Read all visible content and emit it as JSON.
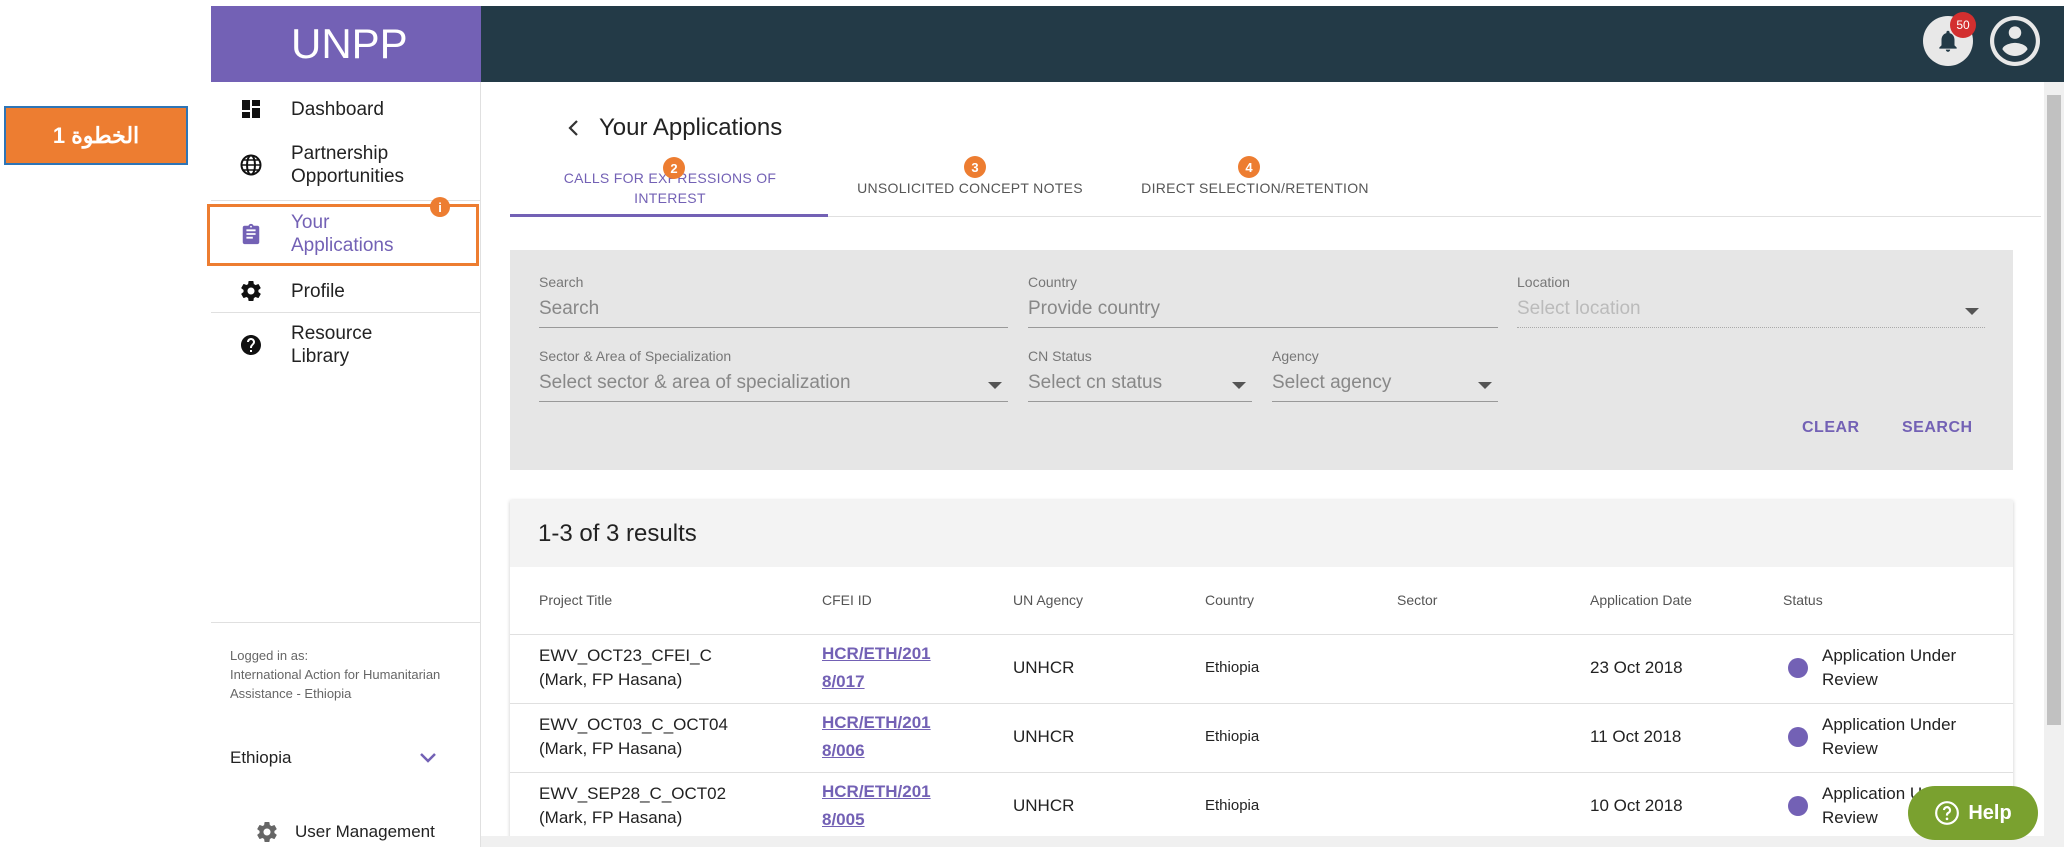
{
  "callout": {
    "label": "الخطوة 1"
  },
  "brand": {
    "name": "UNPP"
  },
  "topbar": {
    "notification_count": "50"
  },
  "sidebar": {
    "items": [
      {
        "label": "Dashboard",
        "icon": "dashboard-icon"
      },
      {
        "label": "Partnership Opportunities",
        "icon": "globe-icon"
      },
      {
        "label": "Your Applications",
        "icon": "clipboard-icon"
      },
      {
        "label": "Profile",
        "icon": "gear-icon"
      },
      {
        "label": "Resource Library",
        "icon": "help-circle-icon"
      }
    ],
    "logged_in_label": "Logged in as:",
    "logged_in_org": "International Action for Humanitarian Assistance - Ethiopia",
    "country": "Ethiopia",
    "user_management": "User Management"
  },
  "markers": {
    "m1": "i",
    "m2": "2",
    "m3": "3",
    "m4": "4"
  },
  "page": {
    "title": "Your Applications",
    "tabs": [
      {
        "label": "CALLS FOR EXPRESSIONS OF INTEREST"
      },
      {
        "label": "UNSOLICITED CONCEPT NOTES"
      },
      {
        "label": "DIRECT SELECTION/RETENTION"
      }
    ]
  },
  "filters": {
    "search_label": "Search",
    "search_placeholder": "Search",
    "country_label": "Country",
    "country_placeholder": "Provide country",
    "location_label": "Location",
    "location_placeholder": "Select location",
    "sector_label": "Sector & Area of Specialization",
    "sector_placeholder": "Select sector & area of specialization",
    "cn_status_label": "CN Status",
    "cn_status_placeholder": "Select cn status",
    "agency_label": "Agency",
    "agency_placeholder": "Select agency",
    "clear": "CLEAR",
    "search": "SEARCH"
  },
  "results": {
    "summary": "1-3 of 3 results",
    "columns": [
      "Project Title",
      "CFEI ID",
      "UN Agency",
      "Country",
      "Sector",
      "Application Date",
      "Status"
    ],
    "rows": [
      {
        "title_1": "EWV_OCT23_CFEI_C",
        "title_2": "(Mark, FP Hasana)",
        "cfei_1": "HCR/ETH/201",
        "cfei_2": "8/017",
        "agency": "UNHCR",
        "country": "Ethiopia",
        "date": "23 Oct 2018",
        "status_1": "Application Under",
        "status_2": "Review"
      },
      {
        "title_1": "EWV_OCT03_C_OCT04",
        "title_2": "(Mark, FP Hasana)",
        "cfei_1": "HCR/ETH/201",
        "cfei_2": "8/006",
        "agency": "UNHCR",
        "country": "Ethiopia",
        "date": "11 Oct 2018",
        "status_1": "Application Under",
        "status_2": "Review"
      },
      {
        "title_1": "EWV_SEP28_C_OCT02",
        "title_2": "(Mark, FP Hasana)",
        "cfei_1": "HCR/ETH/201",
        "cfei_2": "8/005",
        "agency": "UNHCR",
        "country": "Ethiopia",
        "date": "10 Oct 2018",
        "status_1": "Application U",
        "status_2": "Review"
      }
    ]
  },
  "help": {
    "label": "Help"
  },
  "colors": {
    "brand": "#7361b5",
    "topbar": "#233a47",
    "callout": "#ed7d31",
    "help": "#7aa12f"
  }
}
